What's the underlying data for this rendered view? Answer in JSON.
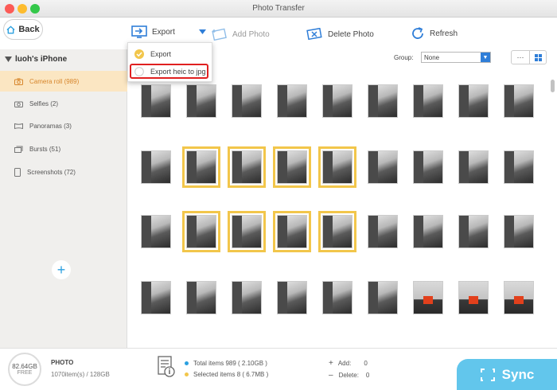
{
  "window": {
    "title": "Photo Transfer"
  },
  "toolbar": {
    "back": "Back",
    "export": "Export",
    "add_photo": "Add Photo",
    "delete_photo": "Delete Photo",
    "refresh": "Refresh"
  },
  "export_menu": {
    "items": [
      {
        "label": "Export"
      },
      {
        "label": "Export heic to jpg"
      }
    ]
  },
  "sidebar": {
    "device": "luoh's iPhone",
    "albums": [
      {
        "label": "Camera roll (989)",
        "active": true
      },
      {
        "label": "Selfies (2)"
      },
      {
        "label": "Panoramas (3)"
      },
      {
        "label": "Bursts (51)"
      },
      {
        "label": "Screenshots (72)"
      }
    ]
  },
  "group": {
    "label": "Group:",
    "value": "None"
  },
  "storage": {
    "free_size": "82.64GB",
    "free_label": "FREE",
    "type": "PHOTO",
    "items": "1070item(s) / 128GB"
  },
  "summary": {
    "total": "Total items 989 ( 2.10GB )",
    "selected": "Selected items 8 ( 6.7MB )",
    "add_label": "Add:",
    "add_value": "0",
    "delete_label": "Delete:",
    "delete_value": "0"
  },
  "sync_label": "Sync",
  "colors": {
    "accent": "#d7862c",
    "selection": "#f2c64b",
    "sync": "#62c6ec",
    "highlight": "#e02020",
    "export_blue": "#2f7ed8"
  }
}
